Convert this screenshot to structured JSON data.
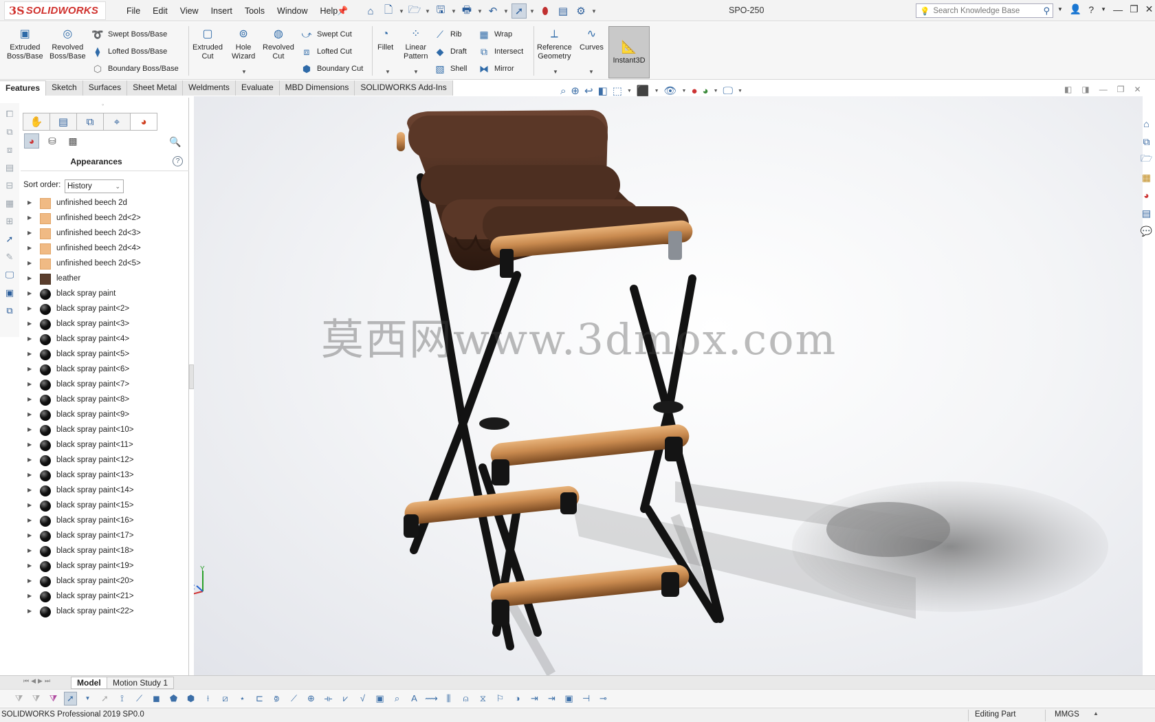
{
  "app": {
    "logo_prefix": "3S",
    "logo_text": "SOLIDWORKS",
    "document_title": "SPO-250"
  },
  "menu": [
    "File",
    "Edit",
    "View",
    "Insert",
    "Tools",
    "Window",
    "Help"
  ],
  "search": {
    "placeholder": "Search Knowledge Base"
  },
  "commands": {
    "extruded_boss": "Extruded\nBoss/Base",
    "revolved_boss": "Revolved\nBoss/Base",
    "swept_boss": "Swept Boss/Base",
    "lofted_boss": "Lofted Boss/Base",
    "boundary_boss": "Boundary Boss/Base",
    "extruded_cut": "Extruded\nCut",
    "hole_wizard": "Hole\nWizard",
    "revolved_cut": "Revolved\nCut",
    "swept_cut": "Swept Cut",
    "lofted_cut": "Lofted Cut",
    "boundary_cut": "Boundary Cut",
    "fillet": "Fillet",
    "linear_pattern": "Linear\nPattern",
    "rib": "Rib",
    "draft": "Draft",
    "shell": "Shell",
    "wrap": "Wrap",
    "intersect": "Intersect",
    "mirror": "Mirror",
    "reference_geometry": "Reference\nGeometry",
    "curves": "Curves",
    "instant3d": "Instant3D"
  },
  "tabs": [
    "Features",
    "Sketch",
    "Surfaces",
    "Sheet Metal",
    "Weldments",
    "Evaluate",
    "MBD Dimensions",
    "SOLIDWORKS Add-Ins"
  ],
  "panel": {
    "title": "Appearances",
    "sort_label": "Sort order:",
    "sort_value": "History",
    "items": [
      {
        "label": "unfinished beech 2d",
        "swatch": "beech"
      },
      {
        "label": "unfinished beech 2d<2>",
        "swatch": "beech"
      },
      {
        "label": "unfinished beech 2d<3>",
        "swatch": "beech"
      },
      {
        "label": "unfinished beech 2d<4>",
        "swatch": "beech"
      },
      {
        "label": "unfinished beech 2d<5>",
        "swatch": "beech"
      },
      {
        "label": "leather",
        "swatch": "leather"
      },
      {
        "label": "black spray paint",
        "swatch": "black"
      },
      {
        "label": "black spray paint<2>",
        "swatch": "black"
      },
      {
        "label": "black spray paint<3>",
        "swatch": "black"
      },
      {
        "label": "black spray paint<4>",
        "swatch": "black"
      },
      {
        "label": "black spray paint<5>",
        "swatch": "black"
      },
      {
        "label": "black spray paint<6>",
        "swatch": "black"
      },
      {
        "label": "black spray paint<7>",
        "swatch": "black"
      },
      {
        "label": "black spray paint<8>",
        "swatch": "black"
      },
      {
        "label": "black spray paint<9>",
        "swatch": "black"
      },
      {
        "label": "black spray paint<10>",
        "swatch": "black"
      },
      {
        "label": "black spray paint<11>",
        "swatch": "black"
      },
      {
        "label": "black spray paint<12>",
        "swatch": "black"
      },
      {
        "label": "black spray paint<13>",
        "swatch": "black"
      },
      {
        "label": "black spray paint<14>",
        "swatch": "black"
      },
      {
        "label": "black spray paint<15>",
        "swatch": "black"
      },
      {
        "label": "black spray paint<16>",
        "swatch": "black"
      },
      {
        "label": "black spray paint<17>",
        "swatch": "black"
      },
      {
        "label": "black spray paint<18>",
        "swatch": "black"
      },
      {
        "label": "black spray paint<19>",
        "swatch": "black"
      },
      {
        "label": "black spray paint<20>",
        "swatch": "black"
      },
      {
        "label": "black spray paint<21>",
        "swatch": "black"
      },
      {
        "label": "black spray paint<22>",
        "swatch": "black"
      }
    ]
  },
  "viewport": {
    "watermark": "莫西网www.3dmox.com",
    "triad": {
      "x": "X",
      "y": "Y",
      "z": "Z"
    }
  },
  "bottom_tabs": [
    "Model",
    "Motion Study 1"
  ],
  "status": {
    "left": "SOLIDWORKS Professional 2019 SP0.0",
    "mode": "Editing Part",
    "units": "MMGS"
  },
  "colors": {
    "brand": "#d0312d",
    "leather": "#4a2d1f",
    "beech": "#c98a4f",
    "frame": "#1a1a1a",
    "accent": "#2e6aa8"
  }
}
